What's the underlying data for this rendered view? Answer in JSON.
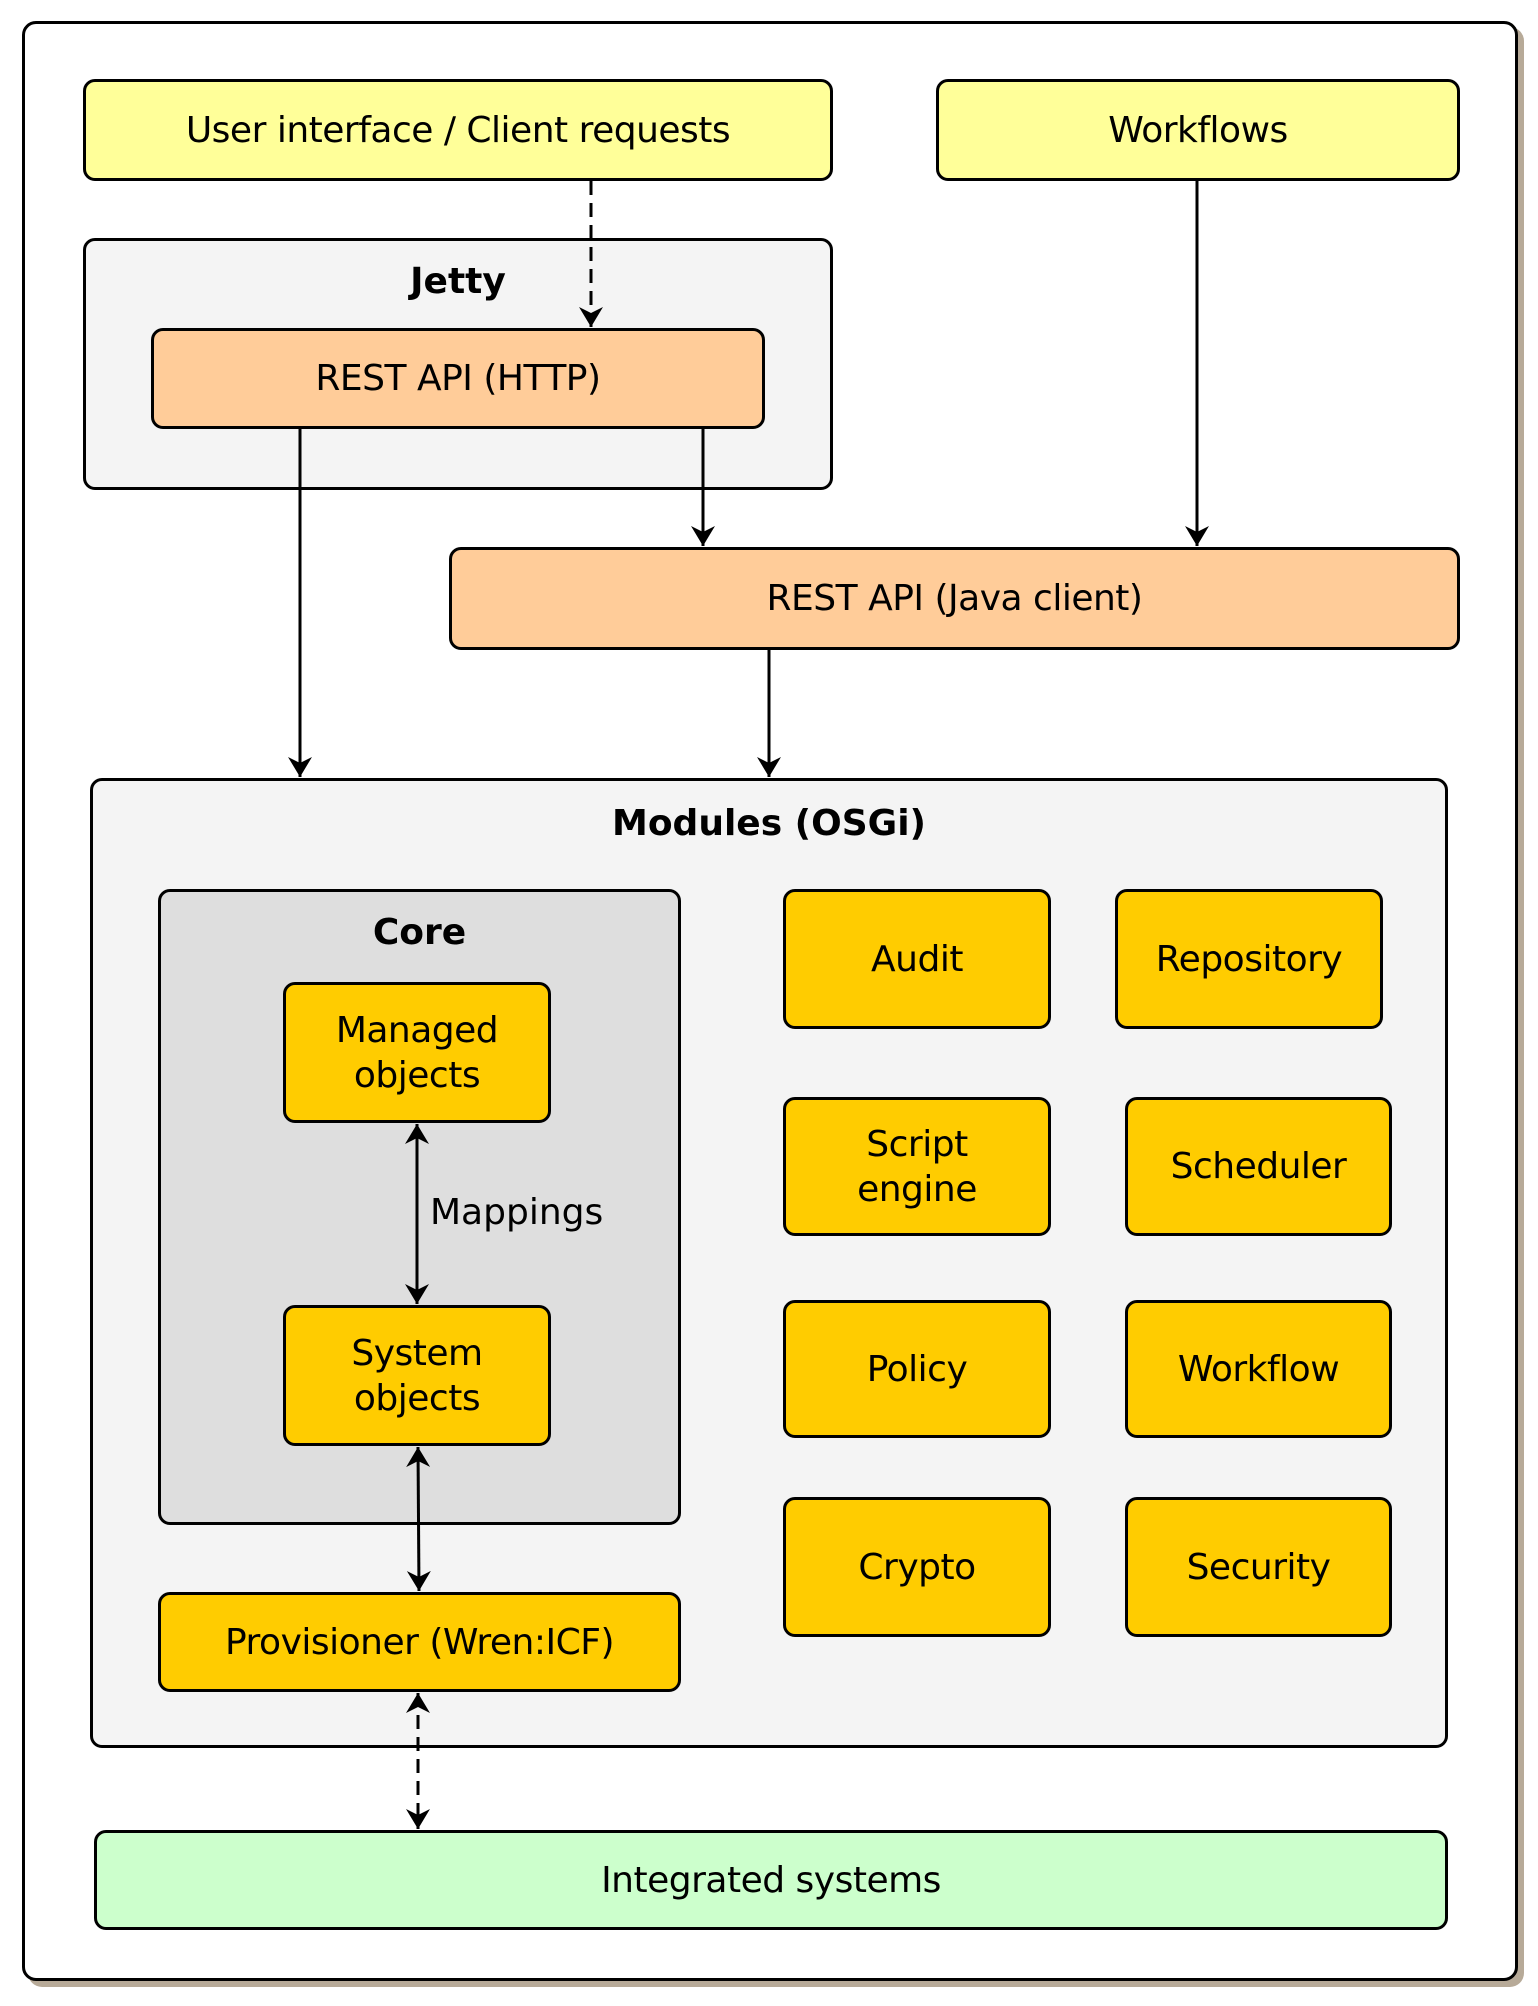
{
  "diagram": {
    "top": {
      "ui": "User interface / Client requests",
      "workflows": "Workflows"
    },
    "jetty": {
      "title": "Jetty",
      "rest_http": "REST API (HTTP)"
    },
    "rest_java": "REST API (Java client)",
    "modules": {
      "title": "Modules (OSGi)",
      "core": {
        "title": "Core",
        "managed": "Managed objects",
        "system": "System objects",
        "mapping_label": "Mappings"
      },
      "provisioner": "Provisioner (Wren:ICF)",
      "items": [
        "Audit",
        "Repository",
        "Script engine",
        "Scheduler",
        "Policy",
        "Workflow",
        "Crypto",
        "Security"
      ]
    },
    "integrated": "Integrated systems"
  },
  "colors": {
    "client": "#ffff99",
    "api": "#ffcc99",
    "module": "#ffcc00",
    "container": "#f4f4f4",
    "core": "#dedede",
    "external": "#ccffcc"
  }
}
